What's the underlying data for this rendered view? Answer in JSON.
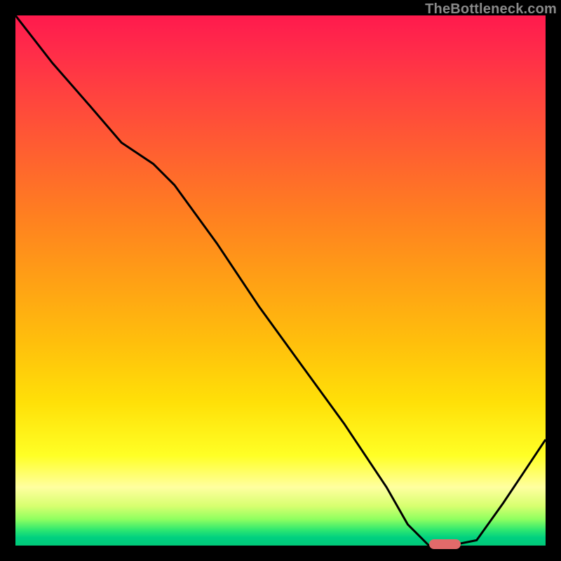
{
  "watermark": "TheBottleneck.com",
  "chart_data": {
    "type": "line",
    "title": "",
    "xlabel": "",
    "ylabel": "",
    "xlim": [
      0,
      100
    ],
    "ylim": [
      0,
      100
    ],
    "series": [
      {
        "name": "curve",
        "x": [
          0,
          7,
          14,
          20,
          26,
          30,
          38,
          46,
          54,
          62,
          70,
          74,
          78,
          82,
          87,
          92,
          96,
          100
        ],
        "values": [
          100,
          91,
          83,
          76,
          72,
          68,
          57,
          45,
          34,
          23,
          11,
          4,
          0,
          0,
          1,
          8,
          14,
          20
        ]
      }
    ],
    "marker": {
      "x_start": 78,
      "x_end": 84,
      "y": 0
    },
    "gradient_stops": [
      {
        "pct": 0,
        "color": "#ff1a4d"
      },
      {
        "pct": 0.83,
        "color": "#ffff25"
      },
      {
        "pct": 1.0,
        "color": "#00c878"
      }
    ]
  }
}
